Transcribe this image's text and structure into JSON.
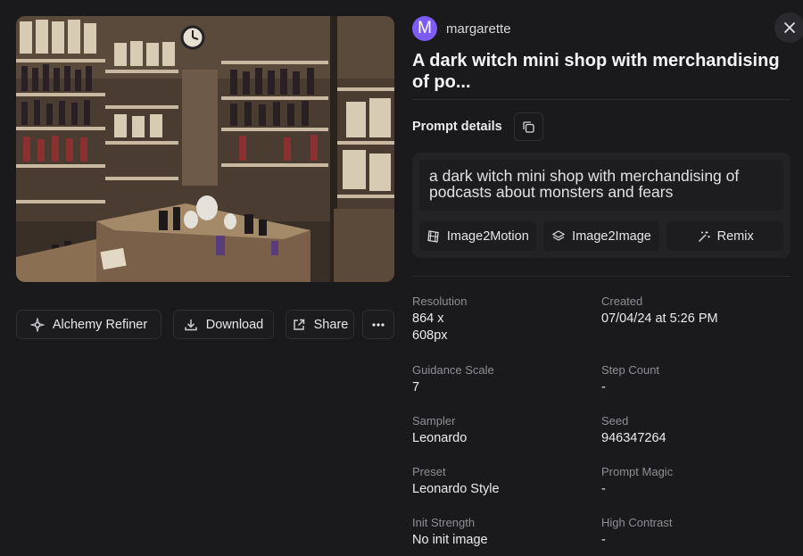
{
  "user": {
    "avatar_letter": "M",
    "name": "margarette"
  },
  "title": "A dark witch mini shop with merchandising of po...",
  "prompt": {
    "label": "Prompt details",
    "text": "a dark witch mini shop with merchandising of podcasts about monsters and fears",
    "actions": [
      "Image2Motion",
      "Image2Image",
      "Remix"
    ]
  },
  "image_actions": {
    "alchemy": "Alchemy Refiner",
    "download": "Download",
    "share": "Share"
  },
  "details": [
    {
      "label": "Resolution",
      "value": "864 x 608px"
    },
    {
      "label": "Created",
      "value": "07/04/24 at 5:26 PM"
    },
    {
      "label": "Guidance Scale",
      "value": "7"
    },
    {
      "label": "Step Count",
      "value": "-"
    },
    {
      "label": "Sampler",
      "value": "Leonardo"
    },
    {
      "label": "Seed",
      "value": "946347264"
    },
    {
      "label": "Preset",
      "value": "Leonardo Style"
    },
    {
      "label": "Prompt Magic",
      "value": "-"
    },
    {
      "label": "Init Strength",
      "value": "No init image"
    },
    {
      "label": "High Contrast",
      "value": "-"
    }
  ],
  "colors": {
    "background": "#1a1a1c",
    "avatar": "#7c5cf4",
    "panel": "#232326"
  }
}
